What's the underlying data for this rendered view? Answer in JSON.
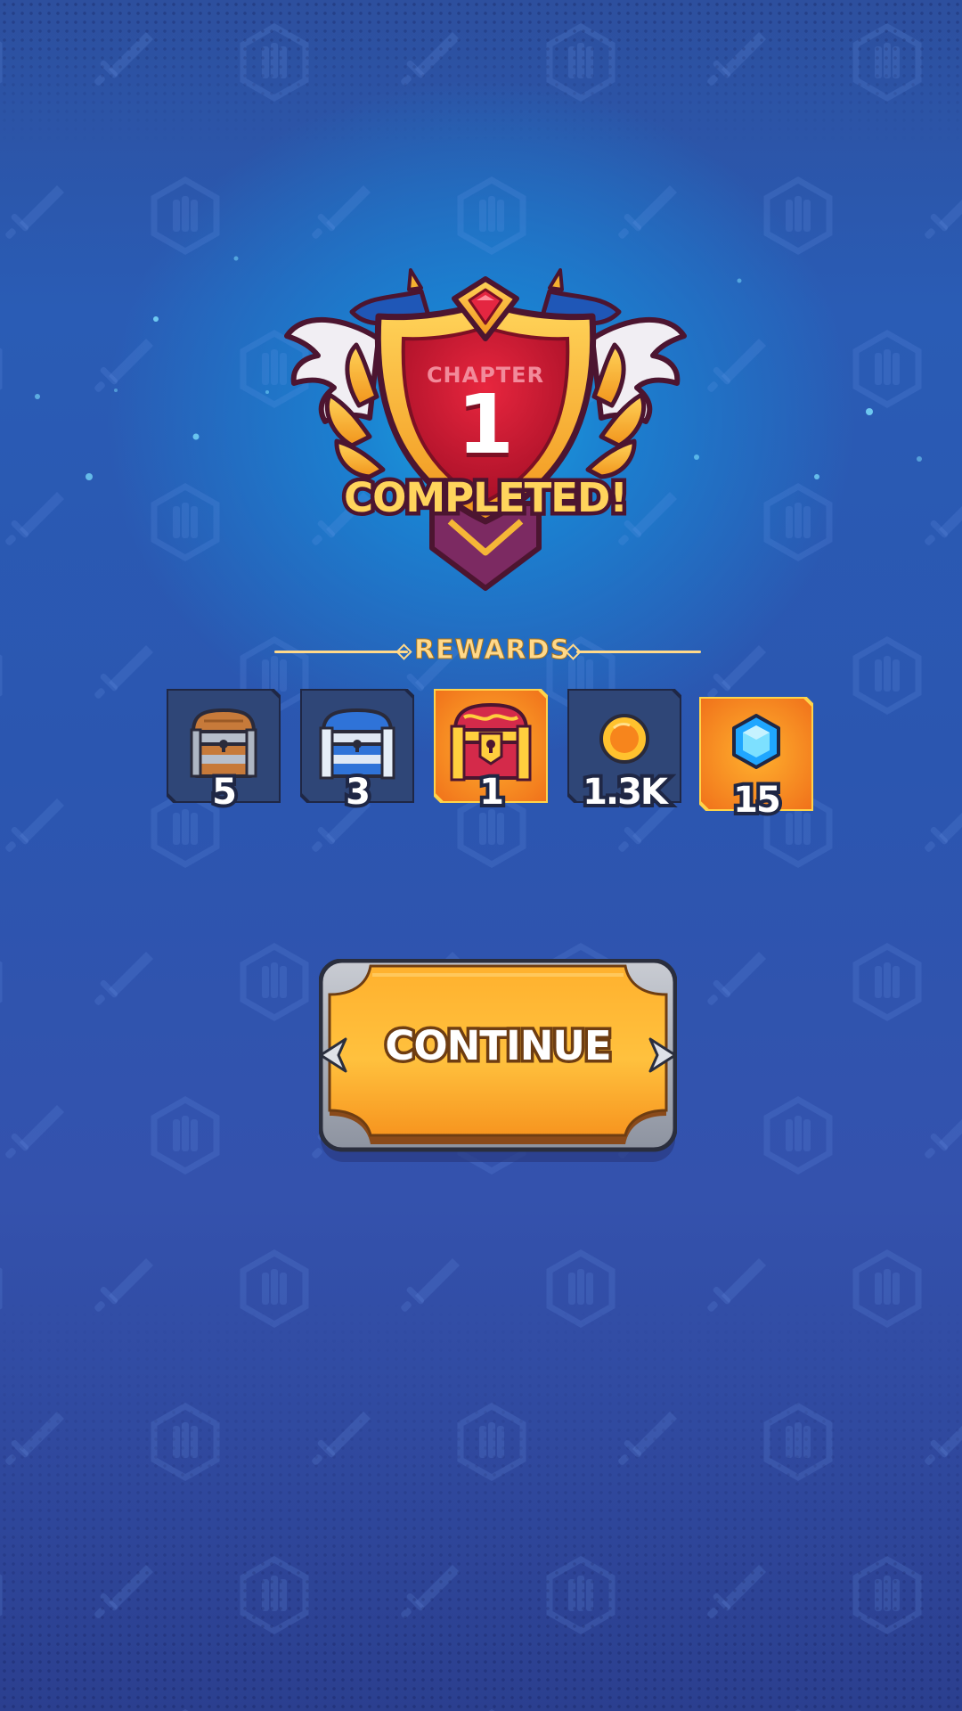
{
  "badge": {
    "chapter_label": "CHAPTER",
    "chapter_number": "1",
    "status": "COMPLETED!"
  },
  "rewards": {
    "title": "REWARDS",
    "items": [
      {
        "icon": "wooden-chest-icon",
        "count": "5"
      },
      {
        "icon": "blue-chest-icon",
        "count": "3"
      },
      {
        "icon": "red-gold-chest-icon",
        "count": "1"
      },
      {
        "icon": "coin-icon",
        "count": "1.3K"
      },
      {
        "icon": "gem-icon",
        "count": "15"
      }
    ]
  },
  "continue_button": {
    "label": "CONTINUE"
  },
  "colors": {
    "background": "#2b56b0",
    "glow": "#1aa3e0",
    "title_gold": "#ffd98a",
    "badge_red": "#c8142f",
    "button_orange": "#ffb532",
    "tile_navy": "#2f4677",
    "tile_highlight": "#f77d1c"
  }
}
